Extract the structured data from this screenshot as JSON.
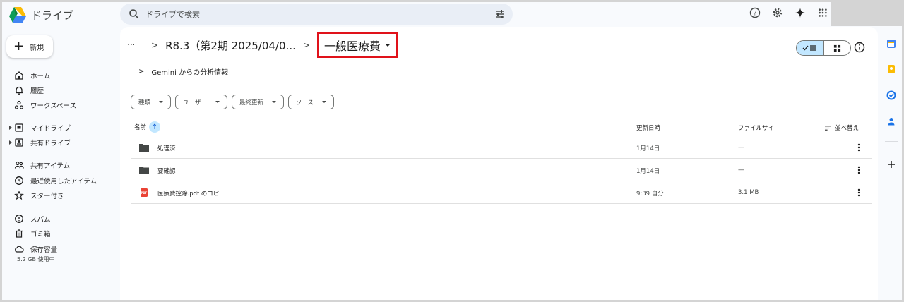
{
  "app": {
    "title": "ドライブ"
  },
  "search": {
    "placeholder": "ドライブで検索"
  },
  "sidebar": {
    "new_label": "新規",
    "items": [
      {
        "label": "ホーム",
        "icon": "home-icon"
      },
      {
        "label": "履歴",
        "icon": "bell-icon"
      },
      {
        "label": "ワークスペース",
        "icon": "workspace-icon"
      },
      {
        "label": "マイドライブ",
        "icon": "my-drive-icon"
      },
      {
        "label": "共有ドライブ",
        "icon": "shared-drive-icon"
      },
      {
        "label": "共有アイテム",
        "icon": "people-icon"
      },
      {
        "label": "最近使用したアイテム",
        "icon": "clock-icon"
      },
      {
        "label": "スター付き",
        "icon": "star-icon"
      },
      {
        "label": "スパム",
        "icon": "spam-icon"
      },
      {
        "label": "ゴミ箱",
        "icon": "trash-icon"
      },
      {
        "label": "保存容量",
        "icon": "cloud-icon"
      }
    ],
    "storage_used": "5.2 GB 使用中"
  },
  "breadcrumb": {
    "ellipsis": "···",
    "parent": "R8.3（第2期 2025/04/0...",
    "current": "一般医療費"
  },
  "gemini": {
    "label": "Gemini からの分析情報"
  },
  "filters": [
    "種類",
    "ユーザー",
    "最終更新",
    "ソース"
  ],
  "table": {
    "headers": {
      "name": "名前",
      "modified": "更新日時",
      "size": "ファイルサイ",
      "sort": "並べ替え"
    },
    "rows": [
      {
        "name": "処理済",
        "modified": "1月14日",
        "size": "—",
        "type": "folder"
      },
      {
        "name": "要確認",
        "modified": "1月14日",
        "size": "—",
        "type": "folder"
      },
      {
        "name": "医療費控除.pdf のコピー",
        "modified": "9:39 自分",
        "size": "3.1 MB",
        "type": "pdf"
      }
    ]
  },
  "colors": {
    "accent": "#0b57d0",
    "selected": "#c2e7ff",
    "highlight_border": "#e0121a",
    "pdf": "#ea4335"
  }
}
